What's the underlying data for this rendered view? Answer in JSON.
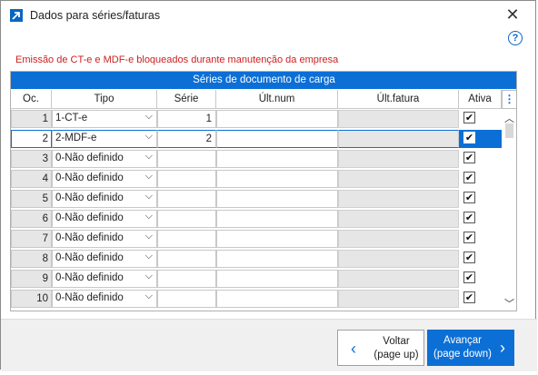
{
  "window": {
    "title": "Dados para séries/faturas",
    "close_label": "✕",
    "help_label": "?"
  },
  "warning": "Emissão de CT-e e MDF-e bloqueados durante manutenção da empresa",
  "grid": {
    "title": "Séries de documento de carga",
    "columns": [
      "Oc.",
      "Tipo",
      "Série",
      "Últ.num",
      "Últ.fatura",
      "Ativa"
    ],
    "menu_label": "⋮",
    "rows": [
      {
        "oc": "1",
        "tipo": "1-CT-e",
        "serie": "1",
        "ult_num": "",
        "ult_fatura": "",
        "ativa": "✔",
        "selected": false
      },
      {
        "oc": "2",
        "tipo": "2-MDF-e",
        "serie": "2",
        "ult_num": "",
        "ult_fatura": "",
        "ativa": "✔",
        "selected": true
      },
      {
        "oc": "3",
        "tipo": "0-Não definido",
        "serie": "",
        "ult_num": "",
        "ult_fatura": "",
        "ativa": "✔",
        "selected": false
      },
      {
        "oc": "4",
        "tipo": "0-Não definido",
        "serie": "",
        "ult_num": "",
        "ult_fatura": "",
        "ativa": "✔",
        "selected": false
      },
      {
        "oc": "5",
        "tipo": "0-Não definido",
        "serie": "",
        "ult_num": "",
        "ult_fatura": "",
        "ativa": "✔",
        "selected": false
      },
      {
        "oc": "6",
        "tipo": "0-Não definido",
        "serie": "",
        "ult_num": "",
        "ult_fatura": "",
        "ativa": "✔",
        "selected": false
      },
      {
        "oc": "7",
        "tipo": "0-Não definido",
        "serie": "",
        "ult_num": "",
        "ult_fatura": "",
        "ativa": "✔",
        "selected": false
      },
      {
        "oc": "8",
        "tipo": "0-Não definido",
        "serie": "",
        "ult_num": "",
        "ult_fatura": "",
        "ativa": "✔",
        "selected": false
      },
      {
        "oc": "9",
        "tipo": "0-Não definido",
        "serie": "",
        "ult_num": "",
        "ult_fatura": "",
        "ativa": "✔",
        "selected": false
      },
      {
        "oc": "10",
        "tipo": "0-Não definido",
        "serie": "",
        "ult_num": "",
        "ult_fatura": "",
        "ativa": "✔",
        "selected": false
      }
    ]
  },
  "footer": {
    "back_label": "Voltar",
    "back_sub": "(page up)",
    "next_label": "Avançar",
    "next_sub": "(page down)"
  },
  "colors": {
    "accent": "#0c6fd6",
    "warning": "#cc1f1f"
  }
}
